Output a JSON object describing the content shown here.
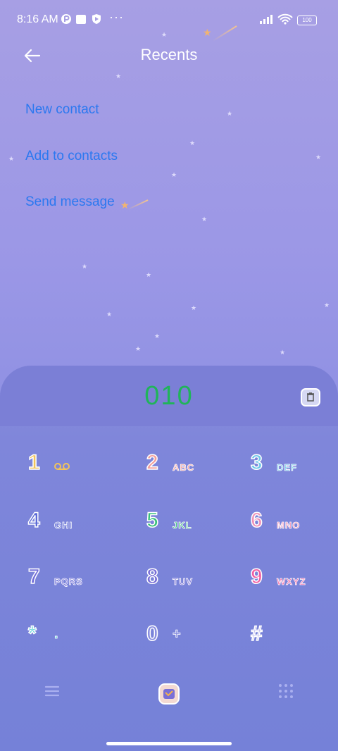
{
  "status_bar": {
    "time": "8:16 AM",
    "more": "···",
    "battery": "100"
  },
  "header": {
    "title": "Recents",
    "back_icon": "arrow-left-icon"
  },
  "actions": [
    "New contact",
    "Add to contacts",
    "Send message"
  ],
  "dialer": {
    "number": "010",
    "keys": [
      {
        "digit": "1",
        "letters": "",
        "icon": "voicemail-icon",
        "digit_color": "#f1c35c",
        "letters_color": "#f1c35c"
      },
      {
        "digit": "2",
        "letters": "ABC",
        "digit_color": "#f4a09b",
        "letters_color": "#f4a09b"
      },
      {
        "digit": "3",
        "letters": "DEF",
        "digit_color": "#6fc7e8",
        "letters_color": "#6fc7e8"
      },
      {
        "digit": "4",
        "letters": "GHI",
        "digit_color": "#5c6ad6",
        "letters_color": "#5c6ad6"
      },
      {
        "digit": "5",
        "letters": "JKL",
        "digit_color": "#39c07a",
        "letters_color": "#39c07a"
      },
      {
        "digit": "6",
        "letters": "MNO",
        "digit_color": "#f08fb5",
        "letters_color": "#f08fb5"
      },
      {
        "digit": "7",
        "letters": "PQRS",
        "digit_color": "#6f6ad8",
        "letters_color": "#6f6ad8"
      },
      {
        "digit": "8",
        "letters": "TUV",
        "digit_color": "#7a6fd6",
        "letters_color": "#7a6fd6"
      },
      {
        "digit": "9",
        "letters": "WXYZ",
        "digit_color": "#f25ca1",
        "letters_color": "#f25ca1"
      },
      {
        "digit": "*",
        "letters": ".",
        "digit_color": "#5fd0d8",
        "letters_color": "#5fd0d8"
      },
      {
        "digit": "0",
        "letters": "+",
        "digit_color": "#8a8fe0",
        "letters_color": "#8a8fe0"
      },
      {
        "digit": "#",
        "letters": "",
        "digit_color": "#b9b6ec",
        "letters_color": "#b9b6ec"
      }
    ]
  },
  "bottom_nav": {
    "menu_icon": "menu-icon",
    "call_icon": "call-button-icon",
    "keypad_icon": "dialpad-icon"
  },
  "colors": {
    "action_blue": "#2b78f0",
    "number_green": "#20b45a"
  }
}
